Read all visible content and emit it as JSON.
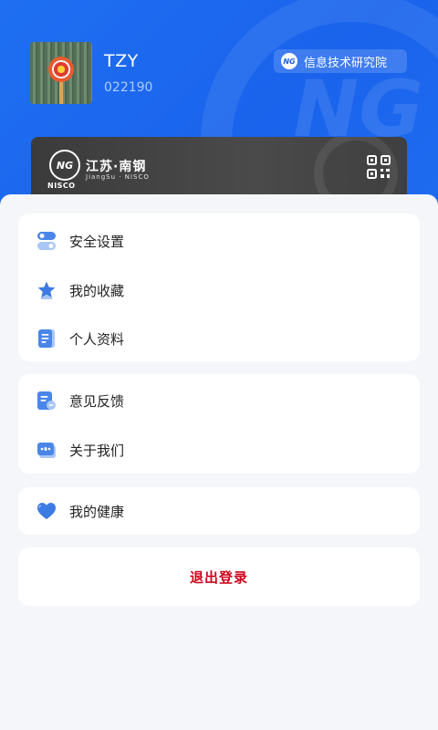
{
  "profile": {
    "name": "TZY",
    "user_id": "022190",
    "org_badge": "信息技术研究院",
    "org_logo_text": "NG"
  },
  "card": {
    "logo_text": "NG",
    "logo_sub": "NISCO",
    "title": "江苏·南钢",
    "subtitle": "JiangSu · NISCO"
  },
  "menu": {
    "group1": [
      {
        "label": "安全设置",
        "icon": "toggle-settings-icon"
      },
      {
        "label": "我的收藏",
        "icon": "star-icon"
      },
      {
        "label": "个人资料",
        "icon": "document-icon"
      }
    ],
    "group2": [
      {
        "label": "意见反馈",
        "icon": "feedback-icon"
      },
      {
        "label": "关于我们",
        "icon": "info-card-icon"
      }
    ],
    "group3": [
      {
        "label": "我的健康",
        "icon": "heart-icon"
      }
    ]
  },
  "logout": {
    "label": "退出登录"
  },
  "colors": {
    "primary_blue": "#1f6ff2",
    "icon_blue": "#4a86e8",
    "logout_red": "#d0021b",
    "card_dark": "#3f3f3f"
  }
}
